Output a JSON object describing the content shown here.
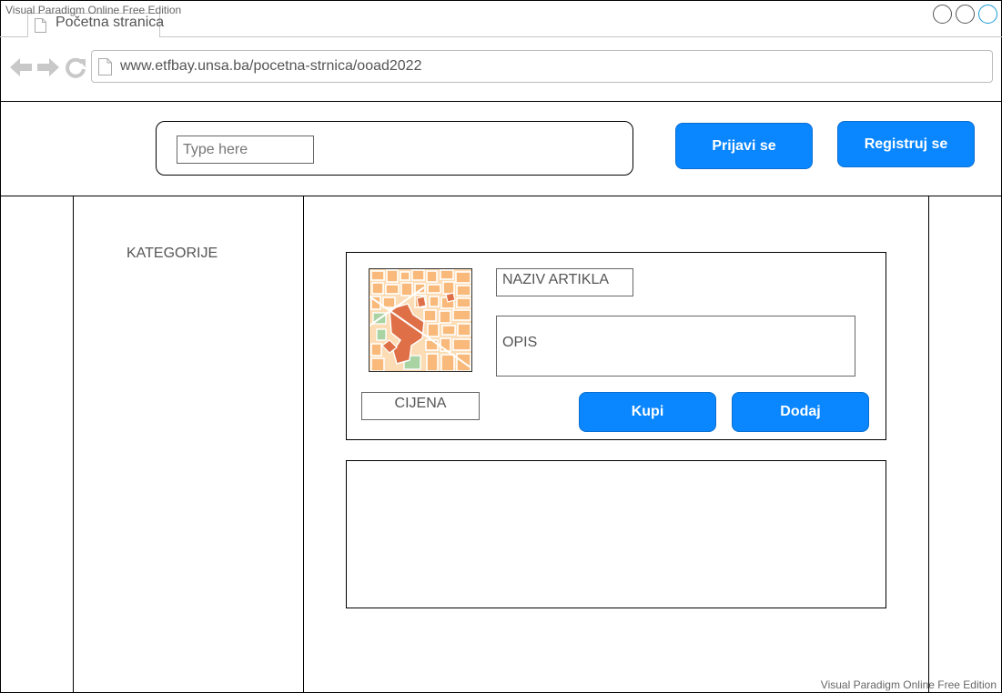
{
  "watermark": "Visual Paradigm Online Free Edition",
  "browser": {
    "tab_title": "Početna stranica",
    "url": "www.etfbay.unsa.ba/pocetna-strnica/ooad2022"
  },
  "header": {
    "search_placeholder": "Type here",
    "login_label": "Prijavi se",
    "register_label": "Registruj se"
  },
  "sidebar": {
    "categories_label": "KATEGORIJE"
  },
  "product": {
    "name_label": "NAZIV ARTIKLA",
    "description_label": "OPIS",
    "price_label": "CIJENA",
    "buy_label": "Kupi",
    "add_label": "Dodaj",
    "image_icon": "map-thumbnail-icon"
  },
  "colors": {
    "accent": "#0a86ff",
    "window_active": "#1a9bd7"
  }
}
